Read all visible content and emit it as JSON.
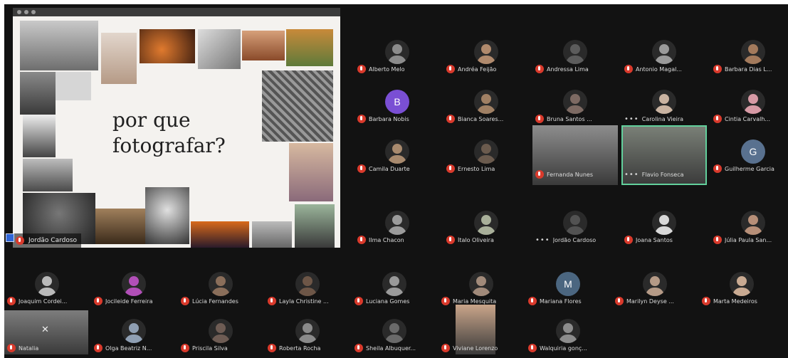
{
  "shared_screen": {
    "title_lines": [
      "por que",
      "fotografar?"
    ],
    "presenter": "Jordão Cardoso"
  },
  "colors": {
    "background": "#121212",
    "muted_mic": "#d93a2c",
    "active_speaker": "#62d09c",
    "name_text": "#dddddd"
  },
  "participants": [
    {
      "name": "Alberto Melo",
      "avatar": "photo",
      "tone": "#8c8c8c",
      "mic": "muted"
    },
    {
      "name": "Andréa Feijão",
      "avatar": "photo",
      "tone": "#b08a6d",
      "mic": "muted"
    },
    {
      "name": "Andressa Lima",
      "avatar": "photo",
      "tone": "#5c5c5c",
      "mic": "muted"
    },
    {
      "name": "Antonio Magal...",
      "avatar": "photo",
      "tone": "#9a9a9a",
      "mic": "muted"
    },
    {
      "name": "Barbara Dias L...",
      "avatar": "photo",
      "tone": "#a37a5c",
      "mic": "muted"
    },
    {
      "name": "Barbara Nobis",
      "avatar": "initial",
      "initial": "B",
      "tone": "#7a4fd4",
      "mic": "muted"
    },
    {
      "name": "Bianca Soares...",
      "avatar": "photo",
      "tone": "#a08064",
      "mic": "muted"
    },
    {
      "name": "Bruna Santos ...",
      "avatar": "photo",
      "tone": "#7d6a63",
      "mic": "muted"
    },
    {
      "name": "Carolina Vieira",
      "avatar": "photo",
      "tone": "#c9b3a1",
      "mic": "more"
    },
    {
      "name": "Cintia Carvalh...",
      "avatar": "photo",
      "tone": "#d79aa5",
      "mic": "muted"
    },
    {
      "name": "Camila Duarte",
      "avatar": "photo",
      "tone": "#a88a6e",
      "mic": "muted"
    },
    {
      "name": "Ernesto Lima",
      "avatar": "photo",
      "tone": "#6b5b4e",
      "mic": "muted"
    },
    {
      "name": "Fernanda Nunes",
      "avatar": "video",
      "tone": "#8d8d8d",
      "mic": "muted"
    },
    {
      "name": "Flavio Fonseca",
      "avatar": "video",
      "tone": "#7b8178",
      "mic": "more",
      "active": true
    },
    {
      "name": "Guilherme Garcia",
      "avatar": "initial",
      "initial": "G",
      "tone": "#59718f",
      "mic": "muted"
    },
    {
      "name": "Ilma Chacon",
      "avatar": "photo",
      "tone": "#9b9b9b",
      "mic": "muted"
    },
    {
      "name": "Ítalo Oliveira",
      "avatar": "photo",
      "tone": "#a9b09a",
      "mic": "muted"
    },
    {
      "name": "Jordão Cardoso",
      "avatar": "photo",
      "tone": "#525252",
      "mic": "more"
    },
    {
      "name": "Joana Santos",
      "avatar": "photo",
      "tone": "#d8d8d8",
      "mic": "muted"
    },
    {
      "name": "Júlia Paula San...",
      "avatar": "photo",
      "tone": "#b78f78",
      "mic": "muted"
    },
    {
      "name": "Joaquim Cordei...",
      "avatar": "photo",
      "tone": "#b9b9b9",
      "mic": "muted"
    },
    {
      "name": "Jocileide Ferreira",
      "avatar": "photo",
      "tone": "#b24fb8",
      "mic": "muted"
    },
    {
      "name": "Lúcia Fernandes",
      "avatar": "photo",
      "tone": "#8a6e5a",
      "mic": "muted"
    },
    {
      "name": "Layla Christine ...",
      "avatar": "photo",
      "tone": "#6d5647",
      "mic": "muted"
    },
    {
      "name": "Luciana Gomes",
      "avatar": "photo",
      "tone": "#9a9a9a",
      "mic": "muted"
    },
    {
      "name": "Maria Mesquita",
      "avatar": "photo",
      "tone": "#a18a7a",
      "mic": "muted"
    },
    {
      "name": "Mariana Flores",
      "avatar": "initial",
      "initial": "M",
      "tone": "#4b6680",
      "mic": "muted"
    },
    {
      "name": "Marilyn Deyse ...",
      "avatar": "photo",
      "tone": "#b59a86",
      "mic": "muted"
    },
    {
      "name": "Marta Medeiros",
      "avatar": "photo",
      "tone": "#c9aa92",
      "mic": "muted"
    },
    {
      "name": "Natalia",
      "avatar": "video-off",
      "tone": "#7d7d7d",
      "mic": "muted"
    },
    {
      "name": "Olga Beatriz N...",
      "avatar": "photo",
      "tone": "#8f9fb3",
      "mic": "muted"
    },
    {
      "name": "Priscila Silva",
      "avatar": "photo",
      "tone": "#6e5c54",
      "mic": "muted"
    },
    {
      "name": "Roberta Rocha",
      "avatar": "photo",
      "tone": "#8a8a8a",
      "mic": "muted"
    },
    {
      "name": "Sheila Albuquer...",
      "avatar": "photo",
      "tone": "#6a6a6a",
      "mic": "muted"
    },
    {
      "name": "Viviane Lorenzo",
      "avatar": "video",
      "tone": "#c9a58a",
      "mic": "muted"
    },
    {
      "name": "Walquiria gonç...",
      "avatar": "photo",
      "tone": "#8c8c8c",
      "mic": "muted"
    }
  ]
}
